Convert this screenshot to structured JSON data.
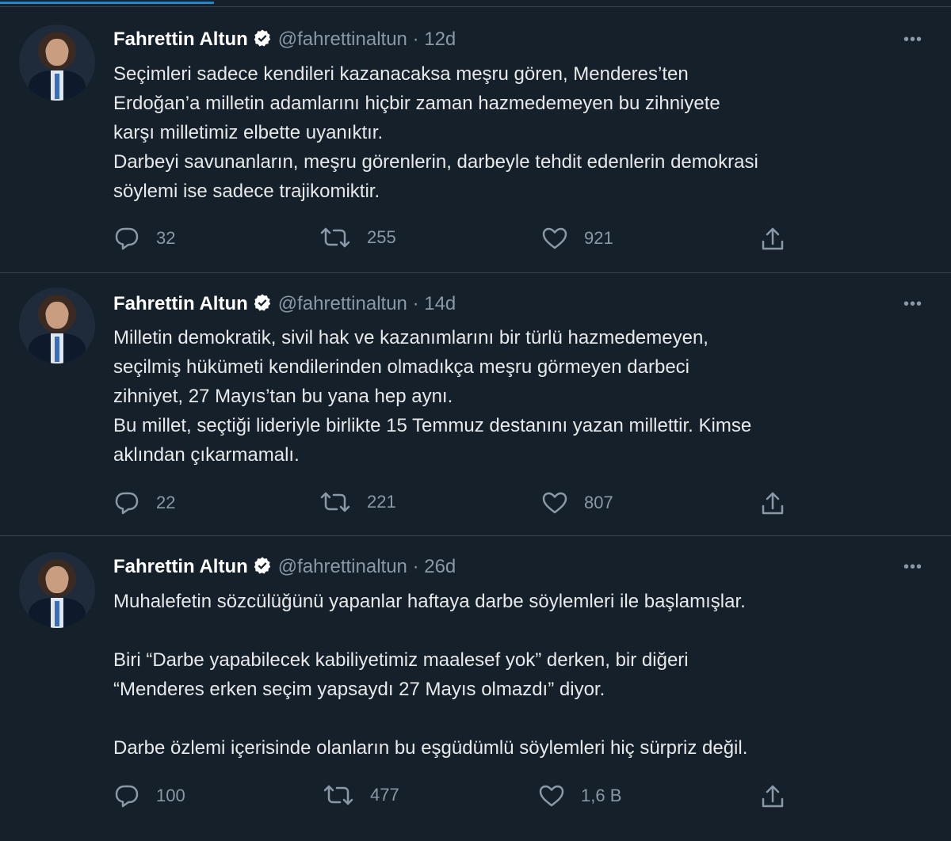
{
  "tweets": [
    {
      "name": "Fahrettin Altun",
      "handle": "@fahrettinaltun",
      "time": "12d",
      "text": "Seçimleri sadece kendileri kazanacaksa meşru gören, Menderes’ten\nErdoğan’a milletin adamlarını hiçbir zaman hazmedemeyen bu zihniyete\nkarşı milletimiz elbette uyanıktır.\nDarbeyi savunanların, meşru görenlerin, darbeyle tehdit edenlerin demokrasi\nsöylemi ise sadece trajikomiktir.",
      "replies": "32",
      "retweets": "255",
      "likes": "921"
    },
    {
      "name": "Fahrettin Altun",
      "handle": "@fahrettinaltun",
      "time": "14d",
      "text": "Milletin demokratik, sivil hak ve kazanımlarını bir türlü hazmedemeyen,\nseçilmiş hükümeti kendilerinden olmadıkça meşru görmeyen darbeci\nzihniyet, 27 Mayıs’tan bu yana hep aynı.\nBu millet, seçtiği lideriyle birlikte 15 Temmuz destanını yazan millettir. Kimse\naklından çıkarmamalı.",
      "replies": "22",
      "retweets": "221",
      "likes": "807"
    },
    {
      "name": "Fahrettin Altun",
      "handle": "@fahrettinaltun",
      "time": "26d",
      "text": "Muhalefetin sözcülüğünü yapanlar haftaya darbe söylemleri ile başlamışlar.\n\nBiri “Darbe yapabilecek kabiliyetimiz maalesef yok” derken, bir diğeri\n“Menderes erken seçim yapsaydı 27 Mayıs olmazdı” diyor.\n\nDarbe özlemi içerisinde olanların bu eşgüdümlü söylemleri hiç sürpriz değil.",
      "replies": "100",
      "retweets": "477",
      "likes": "1,6 B"
    }
  ],
  "separator": "·",
  "more_glyph": "•••",
  "colors": {
    "background": "#15202b",
    "muted": "#8b98a5",
    "accent": "#1d9bf0",
    "divider": "#38444d"
  },
  "icons": [
    "verified-badge-icon",
    "reply-icon",
    "retweet-icon",
    "like-icon",
    "share-icon",
    "more-icon"
  ]
}
